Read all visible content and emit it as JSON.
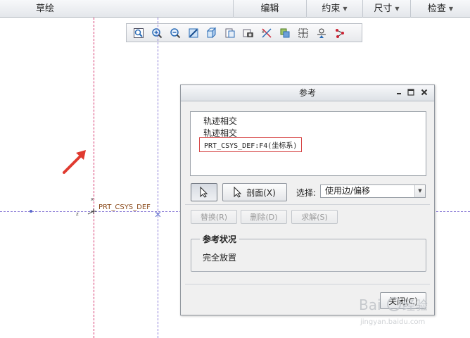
{
  "group_bar": {
    "sketch_label": "草绘",
    "edit_label": "编辑",
    "constrain_label": "约束",
    "dimension_label": "尺寸",
    "inspect_label": "检查"
  },
  "graphics_toolbar": {
    "icons": [
      "refit-icon",
      "zoom-in-icon",
      "zoom-out-icon",
      "repaint-icon",
      "display-style-icon",
      "saved-orientations-icon",
      "view-manager-icon",
      "datum-display-icon",
      "sketcher-display-icon",
      "disp-constraints-icon",
      "disp-grid-icon",
      "disp-vertices-icon"
    ]
  },
  "canvas": {
    "csys_label": "PRT_CSYS_DEF",
    "arrow_color": "#e03a2f",
    "centerline_color": "#d6336c",
    "reference_line_color": "#8a7bd6"
  },
  "dialog": {
    "title": "参考",
    "references": [
      "轨迹相交",
      "轨迹相交",
      "PRT_CSYS_DEF:F4(坐标系)"
    ],
    "xsec_label": "剖面(X)",
    "select_label": "选择:",
    "select_value": "使用边/偏移",
    "replace_label": "替换(R)",
    "delete_label": "删除(D)",
    "solve_label": "求解(S)",
    "status_group_label": "参考状况",
    "status_text": "完全放置",
    "close_label": "关闭(C)",
    "highlight_color": "#d64545"
  },
  "watermark": {
    "text": "Baidu 经验",
    "subtext": "jingyan.baidu.com"
  }
}
